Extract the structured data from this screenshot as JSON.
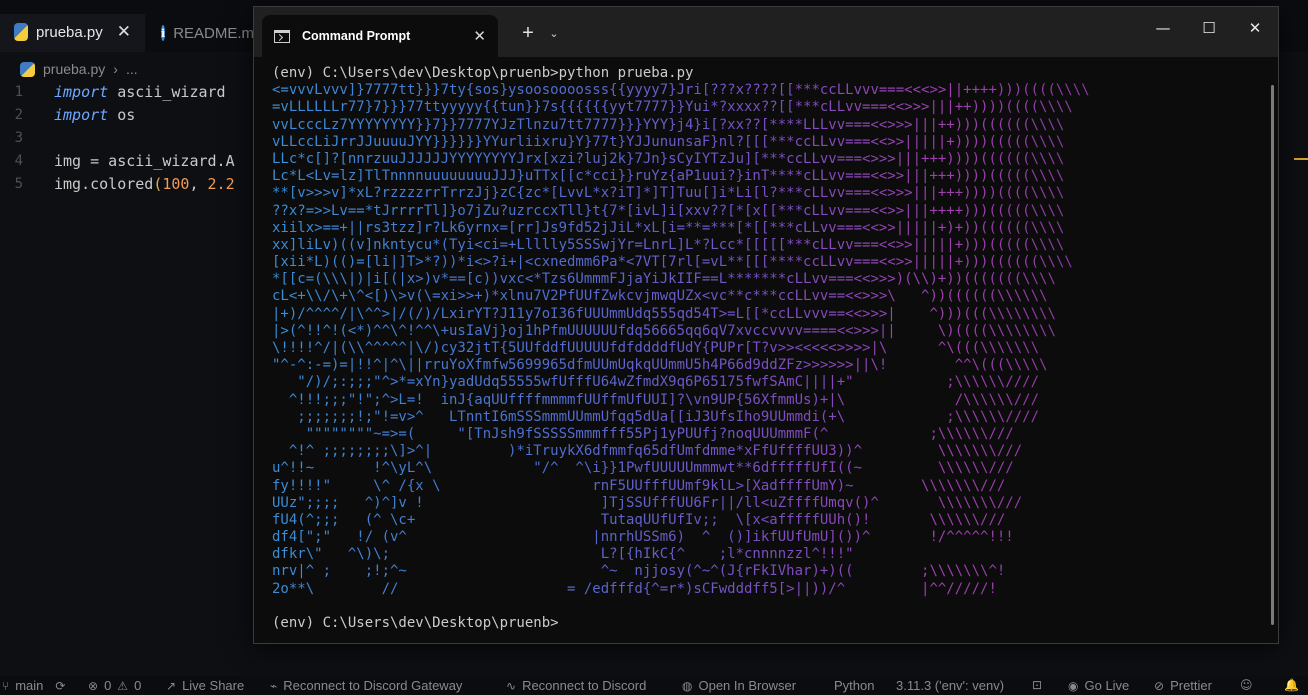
{
  "editor": {
    "tabs": [
      {
        "label": "prueba.py",
        "active": true
      },
      {
        "label": "README.m",
        "active": false
      }
    ],
    "breadcrumb": [
      "prueba.py",
      "..."
    ],
    "line_numbers": [
      "1",
      "2",
      "3",
      "4",
      "5"
    ],
    "code": {
      "l1_kw": "import",
      "l1_rest": " ascii_wizard",
      "l2_kw": "import",
      "l2_rest": " os",
      "l4": "img = ascii_wizard.A",
      "l5_a": "img.colored",
      "l5_p": "(",
      "l5_n1": "100",
      "l5_c": ", ",
      "l5_n2": "2.2"
    }
  },
  "terminal": {
    "title": "Command Prompt",
    "command": "(env) C:\\Users\\dev\\Desktop\\pruenb>python prueba.py",
    "final_prompt": "(env) C:\\Users\\dev\\Desktop\\pruenb>",
    "ascii_output": [
      "<=vvvLvvv]}7777tt}}}7ty{sos}ysoosoooosss{{yyyy7}Jri[???x????[[***ccLLvvv===<<<>>||++++)))((((\\\\\\\\",
      "=vLLLLLLr77}7}}}77ttyyyyy{{tun}}7s{{{{{{yyt7777}}Yui*?xxxx??[[***cLLvv===<<>>>|||++))))((((\\\\\\\\",
      "vvLcccLz7YYYYYYYY}}7}}7777YJzTlnzu7tt7777}}}YYY}j4}i[?xx??[****LLLvv===<<>>>|||++)))((((((\\\\\\\\",
      "vLLccLiJrrJJuuuuJYY}}}}}}YYurliixru}Y}77t}YJJununsaF}nl?[[[***ccLLvv===<<>>|||||+))))(((((\\\\\\\\",
      "LLc*c[]?[nnrzuuJJJJJJYYYYYYYYJrx[xzi?luj2k}7Jn}sCyIYTzJu][***ccLLvv===<>>>|||+++))))((((((\\\\\\\\",
      "Lc*L<Lv=lz]TlTnnnnuuuuuuuuJJJ}uTTx[[c*cci}}ruYz{aP1uui?}inT****cLLvv===<<>>|||+++))))(((((\\\\\\\\",
      "**[v>>>v]*xL?rzzzzrrTrrzJj}zC{zc*[LvvL*x?iT]*]T]Tuu[]i*Li[l?***cLLvv===<<>>>|||+++))))((((\\\\\\\\",
      "??x?=>>Lv==*tJrrrrTl]}o7jZu?uzrccxTll}t{7*[ivL]i[xxv??[*[x[[***cLLvv===<<>>|||++++)))(((((\\\\\\\\",
      "xiilx>==+||rs3tzz]r?Lk6yrnx=[rr]Js9fd52jJiL*xL[i=**=***[*[[***cLLvv===<<>>|||||+)+))((((((\\\\\\\\",
      "xx]liLv)((v]nkntycu*(Tyi<ci=+Llllly5SSSwjYr=LnrL]L*?Lcc*[[[[[***cLLvv===<<>>|||||+)))(((((\\\\\\\\",
      "[xii*L)(()=[li|]T>*?))*i<>?i+|<cxnedmm6Pa*<7VT[7rl[=vL**[[[****ccLLvv===<<>>|||||+)))((((((\\\\\\\\",
      "*[[c=(\\\\\\|)|i[(|x>)v*==[c))vxc<*Tzs6UmmmFJjaYiJkIIF==L*******cLLvv===<<>>>)(\\\\)+))(((((((\\\\\\\\",
      "cL<+\\\\/\\+\\^<[)\\>v(\\=xi>>+)*xlnu7V2PfUUfZwkcvjmwqUZx<vc**c***ccLLvv==<<>>>\\   ^))((((((\\\\\\\\\\\\",
      "|+)/^^^^/|\\^^>|/(/)/LxirYT?J11y7oI36fUUUmmUdq555qd54T>=L[[*ccLLvvv==<<>>>|    ^)))(((\\\\\\\\\\\\\\\\",
      "|>(^!!^!(<*)^^\\^!^^\\+usIaVj}oj1hPfmUUUUUUfdq56665qq6qV7xvccvvvv====<<>>>||     \\)((((\\\\\\\\\\\\\\\\",
      "\\!!!!^/|(\\\\^^^^^|\\/)cy32jtT{5UUfddfUUUUUfdfddddfUdY{PUPr[T?v>><<<<<>>>>|\\      ^\\(((\\\\\\\\\\\\\\",
      "\"^-^:-=)=|!!^|^\\||rruYoXfmfw5699965dfmUUmUqkqUUmmU5h4P66d9ddZFz>>>>>>||\\!        ^^\\(((\\\\\\\\\\",
      "   \"/)/;:;;;\"^>*=xYn}yadUdq55555wfUfffU64wZfmdX9q6P65175fwfSAmC||||+\"           ;\\\\\\\\\\\\////",
      "  ^!!!;;;\"!\";^>L=!  inJ{aqUUffffmmmmfUUffmUfUUI]?\\vn9UP{56XfmmUs)+|\\             /\\\\\\\\\\\\///",
      "   ;;;;;;;!;\"!=v>^   LTnntI6mSSSmmmUUmmUfqq5dUa[[iJ3UfsIho9UUmmdi(+\\            ;\\\\\\\\\\\\////",
      "    \"\"\"\"\"\"\"\"~=>=(     \"[TnJsh9fSSSSSmmmfff55Pj1yPUUfj?noqUUUmmmF(^            ;\\\\\\\\\\\\///",
      "  ^!^ ;;;;;;;;\\]>^|         )*iTruykX6dfmmfq65dfUmfdmme*xFfUffffUU3))^         \\\\\\\\\\\\\\///",
      "u^!!~       !^\\yL^\\            \"/^  ^\\i}}1PwfUUUUUmmmwt**6dfffffUfI((~         \\\\\\\\\\\\///",
      "fy!!!!\"     \\^ /{x \\                  rnF5UUfffUUmf9klL>[XadffffUmY)~        \\\\\\\\\\\\\\///",
      "UUz\";;;;   ^)^]v !                     ]TjSSUfffUU6Fr||/ll<uZffffUmqv()^       \\\\\\\\\\\\\\///",
      "fU4(^;;;   (^ \\c+                      TutaqUUfUfIv;;  \\[x<afffffUUh()!       \\\\\\\\\\\\///",
      "df4[\";\"   !/ (v^                      |nnrhUSSm6)  ^  ()]ikfUUfUmU]())^       !/^^^^^!!!",
      "dfkr\\\"   ^\\)\\;                         L?[{hIkC{^    ;l*cnnnnzzl^!!!\"       ",
      "nrv|^ ;    ;!;^~                       ^~  njjosy(^~^(J{rFkIVhar)+)((        ;\\\\\\\\\\\\\\^!",
      "2o**\\        //                    = /edfffd{^=r*)sCFwdddff5[>||))/^         |^^/////!"
    ]
  },
  "status_bar": {
    "branch": "main",
    "errors": "0",
    "warnings": "0",
    "live_share": "Live Share",
    "discord_gateway": "Reconnect to Discord Gateway",
    "discord": "Reconnect to Discord",
    "open_browser": "Open In Browser",
    "language": "Python",
    "interpreter": "3.11.3 ('env': venv)",
    "go_live": "Go Live",
    "prettier": "Prettier"
  },
  "colors": {
    "ascii_start": "#3a8fd8",
    "ascii_mid": "#7a4fc4",
    "ascii_end": "#a13fb0",
    "keyword": "#6ea8ff",
    "number": "#f29b54"
  }
}
